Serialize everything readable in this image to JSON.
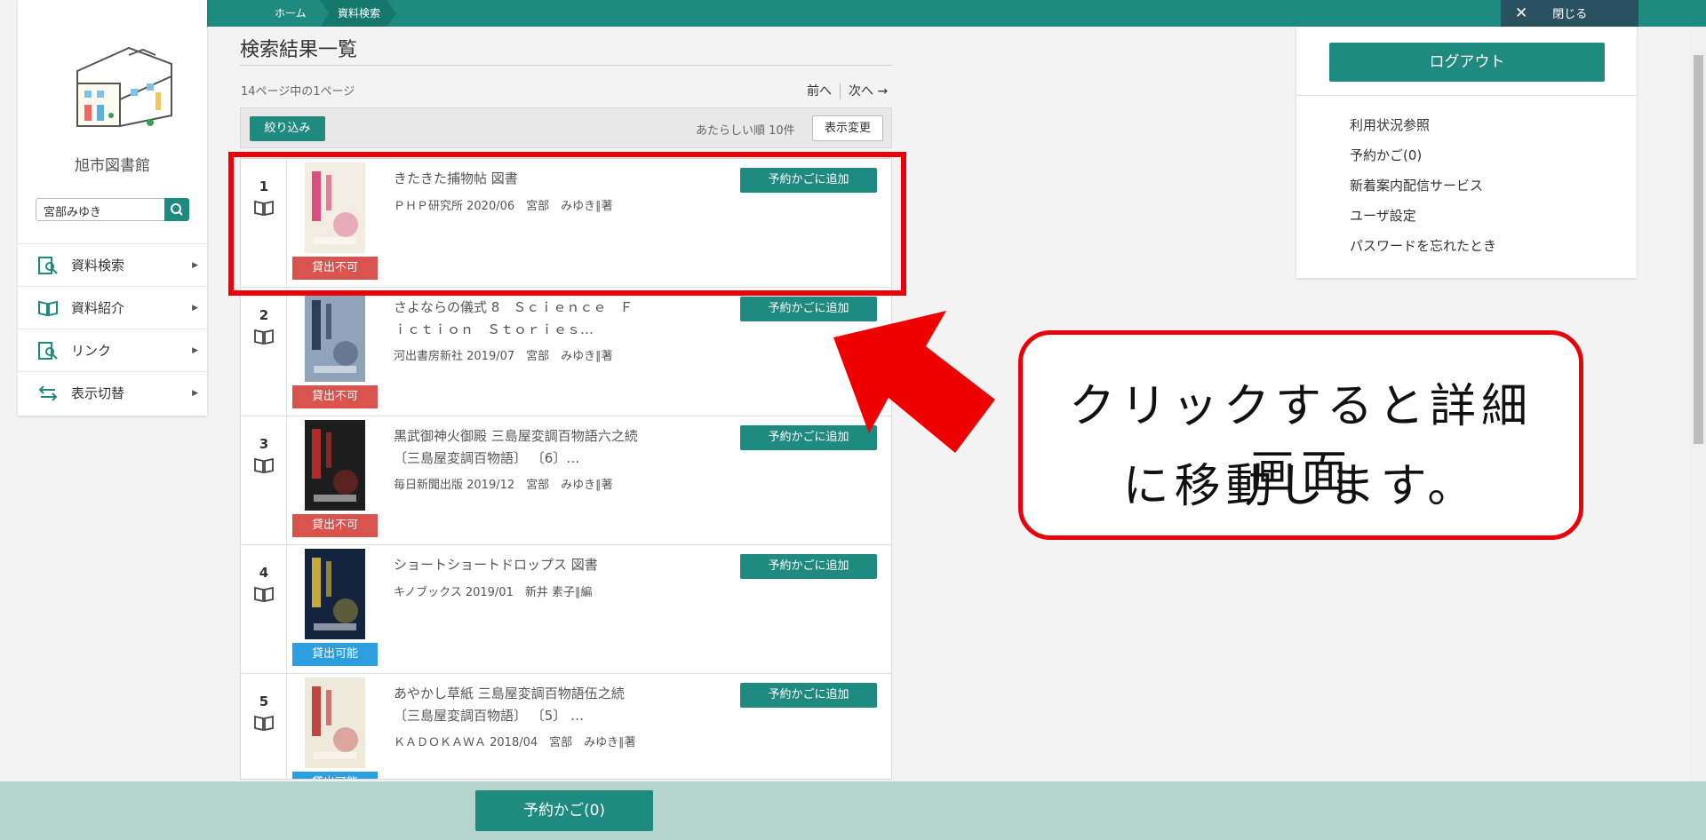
{
  "breadcrumb": [
    "ホーム",
    "資料検索"
  ],
  "close_label": "閉じる",
  "library_name": "旭市図書館",
  "search_value": "宮部みゆき",
  "nav": [
    {
      "label": "資料検索",
      "icon": "search-doc-icon"
    },
    {
      "label": "資料紹介",
      "icon": "open-book-icon"
    },
    {
      "label": "リンク",
      "icon": "link-doc-icon"
    },
    {
      "label": "表示切替",
      "icon": "swap-arrows-icon"
    }
  ],
  "main": {
    "title": "検索結果一覧",
    "page_info": "14ページ中の1ページ",
    "prev_label": "前へ",
    "next_label": "次へ →",
    "filter_label": "絞り込み",
    "sort_label": "あたらしい順 10件",
    "view_label": "表示変更",
    "reserve_label": "予約かごに追加"
  },
  "results": [
    {
      "num": "1",
      "title_line1": "きたきた捕物帖 図書",
      "title_line2": "",
      "meta": "ＰＨＰ研究所 2020/06　宮部　みゆき∥著",
      "status": "貸出不可",
      "status_kind": "ng",
      "cover_color": "#f2ede0",
      "cover_accent": "#d6336c"
    },
    {
      "num": "2",
      "title_line1": "さよならの儀式 8　Ｓｃｉｅｎｃｅ　Ｆ",
      "title_line2": "ｉｃｔｉｏｎ　Ｓｔｏｒｉｅｓ…",
      "meta": "河出書房新社 2019/07　宮部　みゆき∥著",
      "status": "貸出不可",
      "status_kind": "ng",
      "cover_color": "#8fa4b8",
      "cover_accent": "#1c2e45"
    },
    {
      "num": "3",
      "title_line1": "黒武御神火御殿 三島屋変調百物語六之続",
      "title_line2": "〔三島屋変調百物語〕 〔6〕…",
      "meta": "毎日新聞出版 2019/12　宮部　みゆき∥著",
      "status": "貸出不可",
      "status_kind": "ng",
      "cover_color": "#1d1d1d",
      "cover_accent": "#c9302c"
    },
    {
      "num": "4",
      "title_line1": "ショートショートドロップス 図書",
      "title_line2": "",
      "meta": "キノブックス 2019/01　新井 素子∥編",
      "status": "貸出可能",
      "status_kind": "ok",
      "cover_color": "#14243e",
      "cover_accent": "#e8c23a"
    },
    {
      "num": "5",
      "title_line1": "あやかし草紙 三島屋変調百物語伍之続",
      "title_line2": "〔三島屋変調百物語〕 〔5〕 …",
      "meta": "ＫＡＤＯＫＡＷＡ 2018/04　宮部　みゆき∥著",
      "status": "貸出可能",
      "status_kind": "ok",
      "cover_color": "#efe9dc",
      "cover_accent": "#b52a2a"
    }
  ],
  "right_panel": {
    "logout_label": "ログアウト",
    "links": [
      "利用状況参照",
      "予約かご(0)",
      "新着案内配信サービス",
      "ユーザ設定",
      "パスワードを忘れたとき"
    ]
  },
  "cart_label": "予約かご(0)",
  "callout": {
    "line1": "クリックすると詳細画面",
    "line2": "に移動します。"
  },
  "colors": {
    "brand": "#1f8a80",
    "annotation": "#e8000b",
    "unavailable": "#d9534f",
    "available": "#2d9ee0"
  }
}
